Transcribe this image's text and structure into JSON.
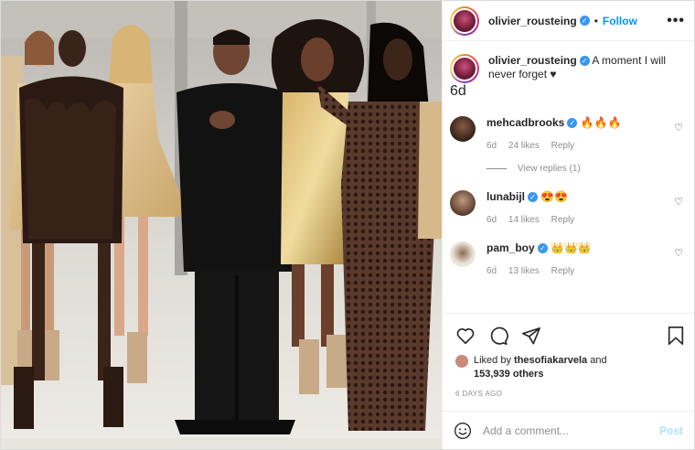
{
  "post": {
    "username": "olivier_rousteing",
    "follow_label": "Follow",
    "dot": "•",
    "more_label": "•••"
  },
  "caption": {
    "username": "olivier_rousteing",
    "text": "A moment I will never forget ♥",
    "age": "6d"
  },
  "comments": [
    {
      "username": "mehcadbrooks",
      "text": "🔥🔥🔥",
      "age": "6d",
      "likes": "24 likes",
      "reply": "Reply",
      "verified": true
    },
    {
      "username": "lunabijl",
      "text": "😍😍",
      "age": "6d",
      "likes": "14 likes",
      "reply": "Reply",
      "verified": true
    },
    {
      "username": "pam_boy",
      "text": "👑👑👑",
      "age": "6d",
      "likes": "13 likes",
      "reply": "Reply",
      "verified": true
    }
  ],
  "view_replies": "View replies (1)",
  "likes": {
    "prefix": "Liked by",
    "user": "thesofiakarvela",
    "and": "and",
    "count": "153,939 others"
  },
  "timestamp": "6 DAYS AGO",
  "add_comment": {
    "placeholder": "Add a comment...",
    "post_label": "Post"
  },
  "colors": {
    "link": "#0095f6",
    "verified": "#3897f0",
    "muted": "#8e8e8e"
  }
}
